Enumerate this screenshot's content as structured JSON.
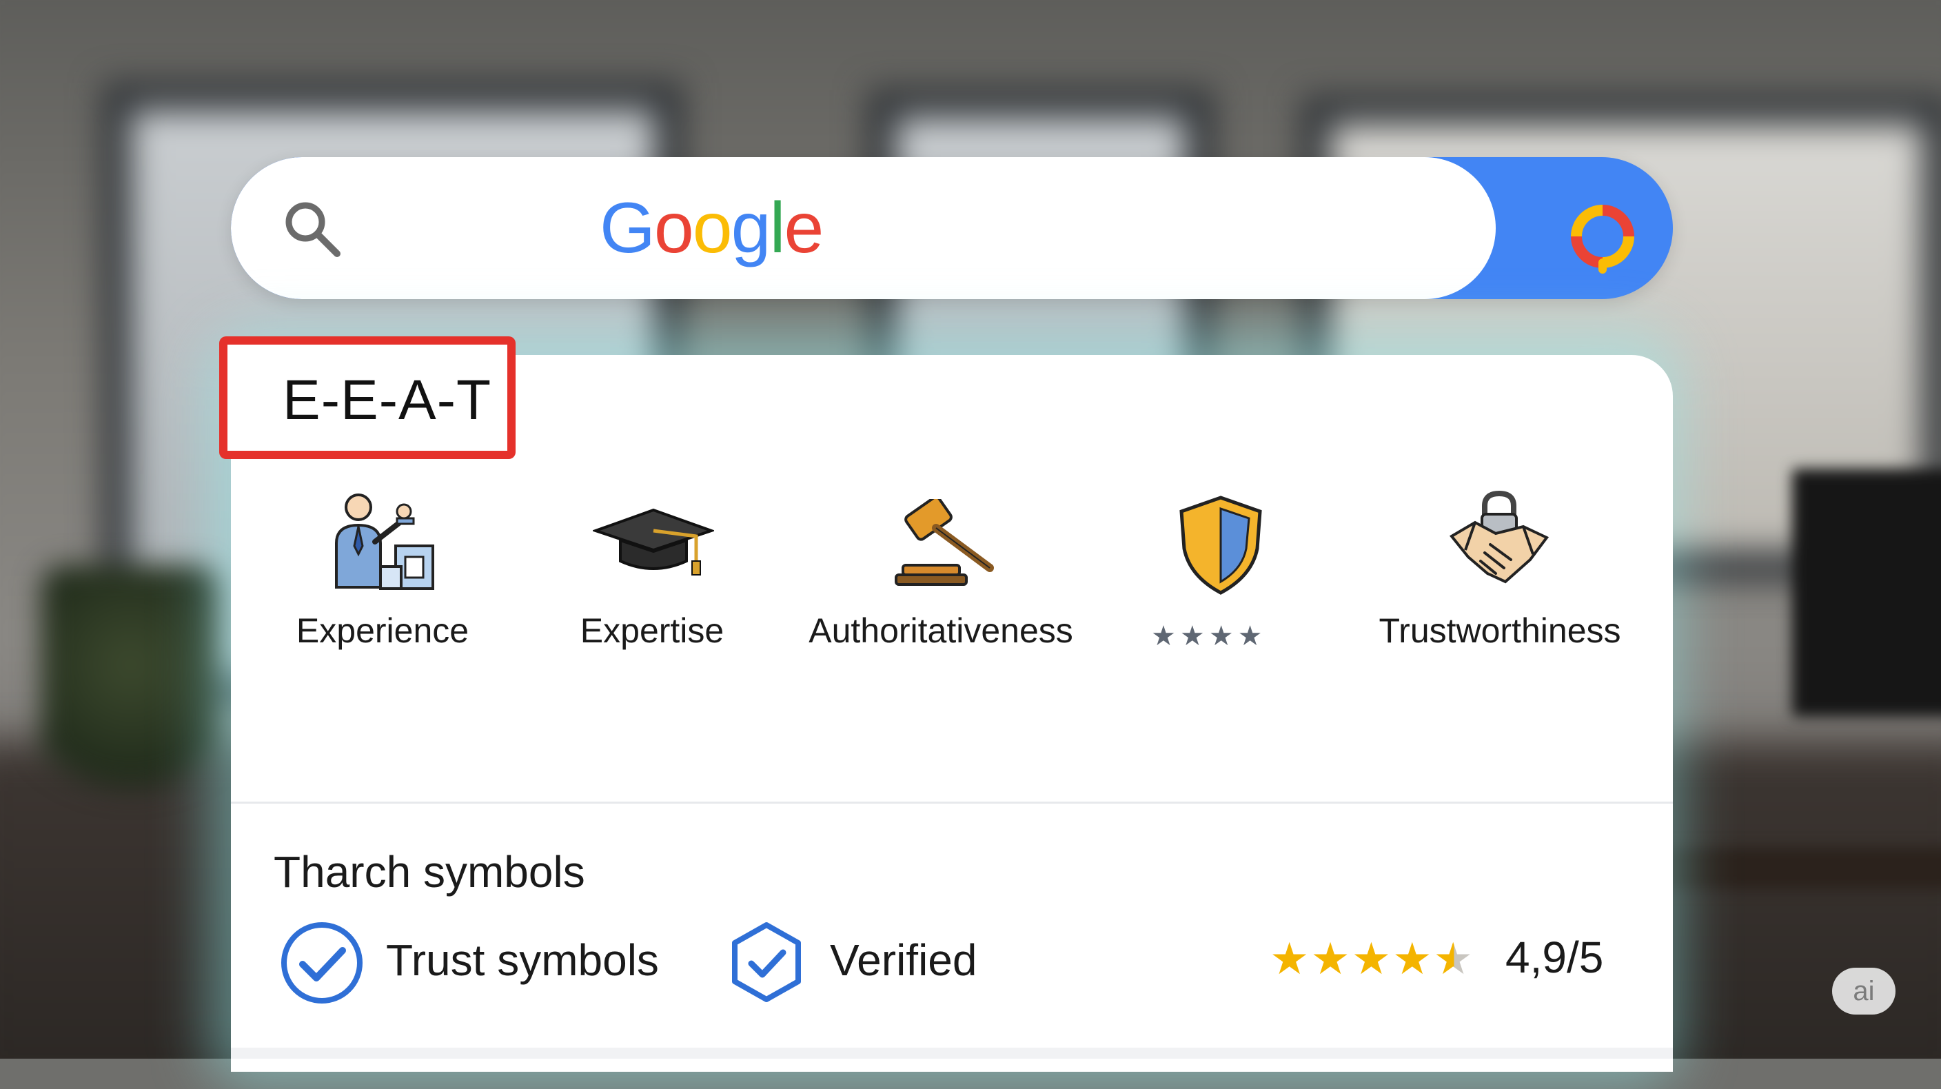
{
  "search": {
    "logo_letters": [
      {
        "char": "G",
        "color": "#4285f4"
      },
      {
        "char": "o",
        "color": "#ea4335"
      },
      {
        "char": "o",
        "color": "#fbbc05"
      },
      {
        "char": "g",
        "color": "#4285f4"
      },
      {
        "char": "l",
        "color": "#34a853"
      },
      {
        "char": "e",
        "color": "#ea4335"
      }
    ],
    "search_icon": "magnifier-icon",
    "assistant_icon": "google-lens-icon",
    "accent_color": "#4285f4"
  },
  "card": {
    "title": "E-E-A-T",
    "highlight_color": "#e5312b",
    "pillars": [
      {
        "label": "Experience",
        "icon": "person-presenting-icon"
      },
      {
        "label": "Expertise",
        "icon": "graduation-cap-icon"
      },
      {
        "label": "Authoritativeness",
        "icon": "gavel-icon"
      },
      {
        "label": "★★★★",
        "icon": "shield-icon"
      },
      {
        "label": "Trustworthiness",
        "icon": "handshake-lock-icon"
      }
    ],
    "section_title": "Tharch symbols",
    "badges": [
      {
        "label": "Trust symbols",
        "icon": "check-circle-icon"
      },
      {
        "label": "Verified",
        "icon": "verified-hexagon-icon"
      }
    ],
    "rating": {
      "value": 4.9,
      "max": 5,
      "text": "4,9/5",
      "stars_full": 4,
      "stars_partial": 1
    }
  },
  "watermark": {
    "text": "ai"
  }
}
